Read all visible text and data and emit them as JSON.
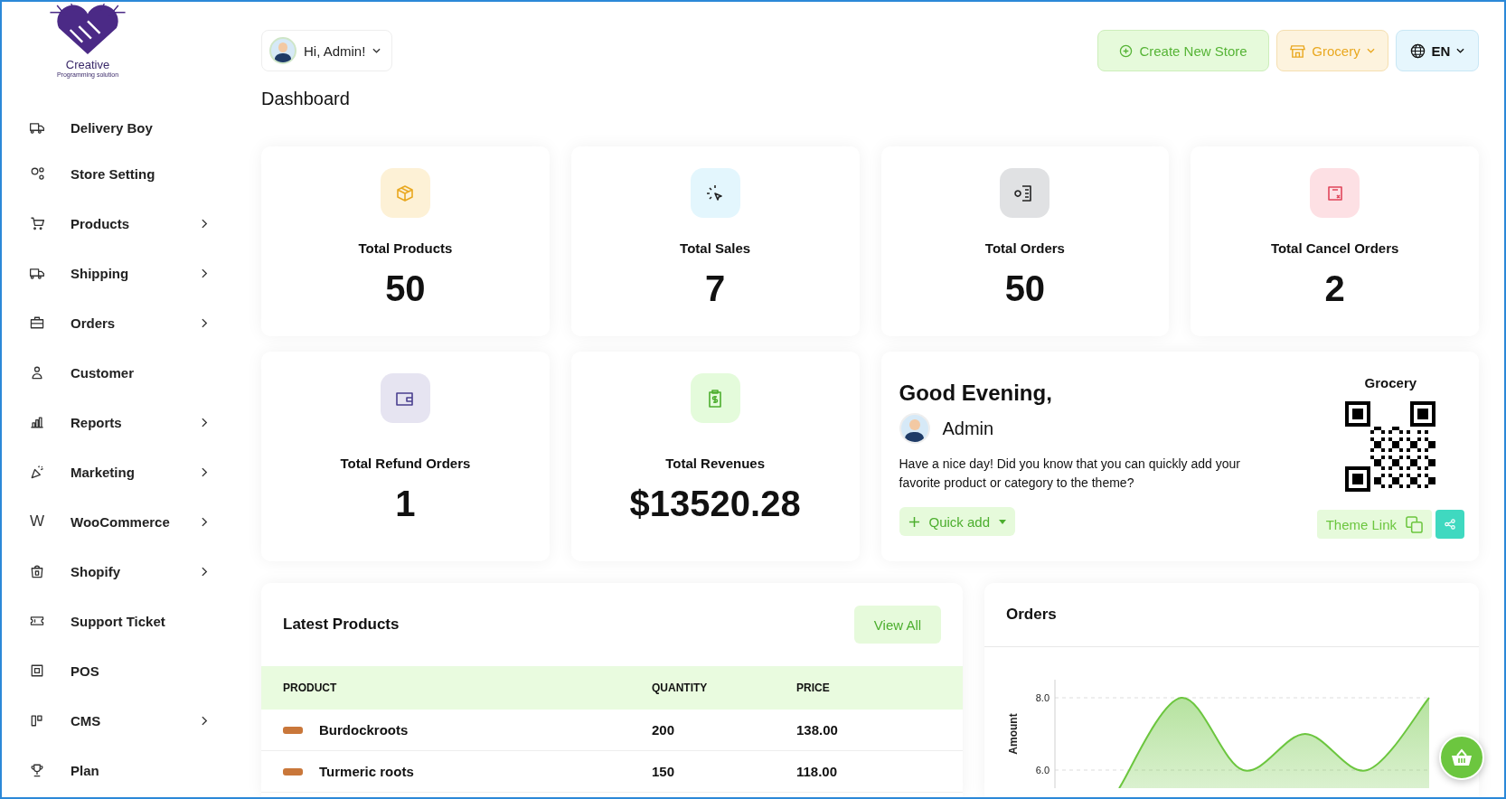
{
  "logo": {
    "name": "Creative",
    "tagline": "Programming solution"
  },
  "sidebar": {
    "items": [
      {
        "label": "Delivery Boy",
        "submenu": false
      },
      {
        "label": "Store Setting",
        "submenu": false
      },
      {
        "label": "Products",
        "submenu": true
      },
      {
        "label": "Shipping",
        "submenu": true
      },
      {
        "label": "Orders",
        "submenu": true
      },
      {
        "label": "Customer",
        "submenu": false
      },
      {
        "label": "Reports",
        "submenu": true
      },
      {
        "label": "Marketing",
        "submenu": true
      },
      {
        "label": "WooCommerce",
        "submenu": true,
        "icon_glyph": "W"
      },
      {
        "label": "Shopify",
        "submenu": true
      },
      {
        "label": "Support Ticket",
        "submenu": false
      },
      {
        "label": "POS",
        "submenu": false
      },
      {
        "label": "CMS",
        "submenu": true
      },
      {
        "label": "Plan",
        "submenu": false
      }
    ]
  },
  "header": {
    "greeting": "Hi, Admin!",
    "create_store": "Create New Store",
    "store": "Grocery",
    "language": "EN"
  },
  "page_title": "Dashboard",
  "stats": [
    {
      "label": "Total Products",
      "value": "50",
      "color": "#fdf1d6"
    },
    {
      "label": "Total Sales",
      "value": "7",
      "color": "#e3f6fd"
    },
    {
      "label": "Total Orders",
      "value": "50",
      "color": "#e0e1e3"
    },
    {
      "label": "Total Cancel Orders",
      "value": "2",
      "color": "#fde0e4"
    },
    {
      "label": "Total Refund Orders",
      "value": "1",
      "color": "#e6e4f1"
    },
    {
      "label": "Total Revenues",
      "value": "$13520.28",
      "color": "#e4fbdb"
    }
  ],
  "welcome": {
    "title": "Good Evening,",
    "name": "Admin",
    "message": "Have a nice day! Did you know that you can quickly add your favorite product or category to the theme?",
    "quick_add": "Quick add",
    "store": "Grocery",
    "theme_link": "Theme Link"
  },
  "latest_products": {
    "title": "Latest Products",
    "view_all": "View All",
    "columns": [
      "PRODUCT",
      "QUANTITY",
      "PRICE"
    ],
    "rows": [
      {
        "product": "Burdockroots",
        "quantity": "200",
        "price": "138.00"
      },
      {
        "product": "Turmeric roots",
        "quantity": "150",
        "price": "118.00"
      }
    ]
  },
  "orders": {
    "title": "Orders",
    "chart_data": {
      "type": "area",
      "ylabel": "Amount",
      "ylim": [
        5.5,
        8.5
      ],
      "yticks": [
        {
          "value": 6,
          "label": "6.0"
        },
        {
          "value": 8,
          "label": "8.0"
        }
      ],
      "series": [
        {
          "color": "#6cc63f",
          "values": [
            5.5,
            8,
            6,
            7,
            6,
            8
          ]
        }
      ]
    }
  }
}
